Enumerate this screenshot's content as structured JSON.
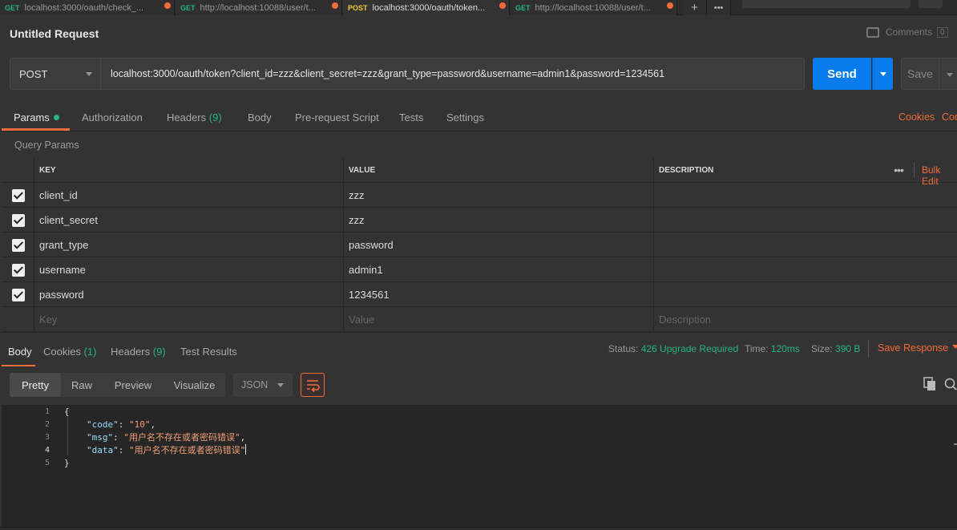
{
  "tabs": [
    {
      "method": "GET",
      "label": "localhost:3000/oauth/check_..."
    },
    {
      "method": "GET",
      "label": "http://localhost:10088/user/t..."
    },
    {
      "method": "POST",
      "label": "localhost:3000/oauth/token..."
    },
    {
      "method": "GET",
      "label": "http://localhost:10088/user/t..."
    }
  ],
  "tab_actions": {
    "add": "+",
    "more": "•••"
  },
  "request": {
    "title": "Untitled Request",
    "comments_label": "Comments",
    "comments_count": "0",
    "method": "POST",
    "url": "localhost:3000/oauth/token?client_id=zzz&client_secret=zzz&grant_type=password&username=admin1&password=1234561",
    "send_label": "Send",
    "save_label": "Save"
  },
  "request_tabs": {
    "params": "Params",
    "authorization": "Authorization",
    "headers": "Headers",
    "headers_count": "(9)",
    "body": "Body",
    "prerequest": "Pre-request Script",
    "tests": "Tests",
    "settings": "Settings",
    "cookies": "Cookies",
    "code": "Code"
  },
  "query_params": {
    "label": "Query Params",
    "columns": {
      "key": "KEY",
      "value": "VALUE",
      "description": "DESCRIPTION"
    },
    "bulk_edit": "Bulk Edit",
    "more": "•••",
    "rows": [
      {
        "key": "client_id",
        "value": "zzz",
        "description": ""
      },
      {
        "key": "client_secret",
        "value": "zzz",
        "description": ""
      },
      {
        "key": "grant_type",
        "value": "password",
        "description": ""
      },
      {
        "key": "username",
        "value": "admin1",
        "description": ""
      },
      {
        "key": "password",
        "value": "1234561",
        "description": ""
      }
    ],
    "placeholders": {
      "key": "Key",
      "value": "Value",
      "description": "Description"
    }
  },
  "response": {
    "tabs": {
      "body": "Body",
      "cookies": "Cookies",
      "cookies_count": "(1)",
      "headers": "Headers",
      "headers_count": "(9)",
      "test_results": "Test Results"
    },
    "status_label": "Status:",
    "status_value": "426 Upgrade Required",
    "time_label": "Time:",
    "time_value": "120ms",
    "size_label": "Size:",
    "size_value": "390 B",
    "save_response": "Save Response",
    "views": {
      "pretty": "Pretty",
      "raw": "Raw",
      "preview": "Preview",
      "visualize": "Visualize"
    },
    "format": "JSON",
    "lines": [
      {
        "n": "1",
        "text": "{"
      },
      {
        "n": "2",
        "key": "\"code\"",
        "value": "\"10\"",
        "trail": ","
      },
      {
        "n": "3",
        "key": "\"msg\"",
        "value": "\"用户名不存在或者密码错误\"",
        "trail": ","
      },
      {
        "n": "4",
        "key": "\"data\"",
        "value": "\"用户名不存在或者密码错误\"",
        "trail": ""
      },
      {
        "n": "5",
        "text": "}"
      }
    ]
  },
  "colors": {
    "accent": "#f26b3a",
    "send": "#097bed",
    "success": "#26b47f"
  }
}
